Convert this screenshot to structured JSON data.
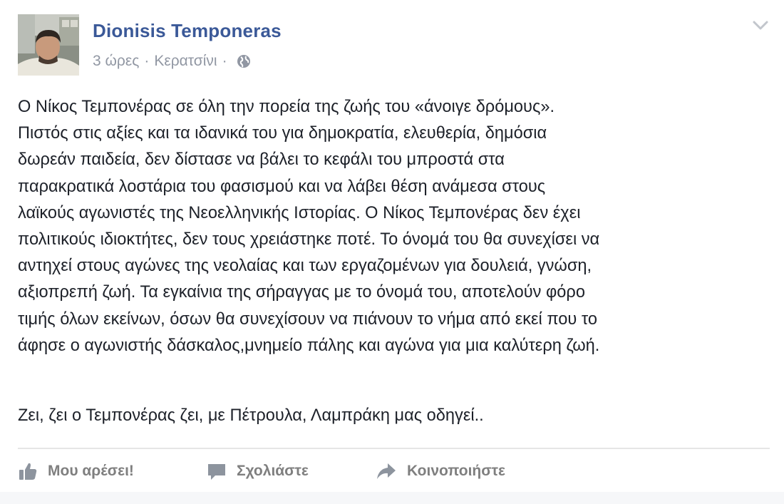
{
  "post": {
    "author": "Dionisis Temponeras",
    "time": "3 ώρες",
    "separator": "·",
    "location": "Κερατσίνι",
    "separator2": "·",
    "paragraph1": "Ο Νίκος Τεμπονέρας σε όλη την πορεία της ζωής του «άνοιγε δρόμους».\nΠιστός στις αξίες και τα ιδανικά του για δημοκρατία, ελευθερία, δημόσια\nδωρεάν παιδεία, δεν δίστασε να βάλει το κεφάλι του μπροστά στα\nπαρακρατικά λοστάρια του φασισμού και να λάβει θέση ανάμεσα στους\nλαϊκούς αγωνιστές της Νεοελληνικής Ιστορίας. Ο Νίκος Τεμπονέρας δεν έχει\nπολιτικούς ιδιοκτήτες, δεν τους χρειάστηκε ποτέ. Το όνομά του θα συνεχίσει να\nαντηχεί στους αγώνες της νεολαίας και των εργαζομένων για δουλειά, γνώση,\nαξιοπρεπή ζωή. Τα εγκαίνια της σήραγγας με το όνομά του, αποτελούν φόρο\nτιμής όλων εκείνων, όσων θα συνεχίσουν να πιάνουν το νήμα από εκεί που το\nάφησε ο αγωνιστής δάσκαλος,μνημείο πάλης και αγώνα για μια καλύτερη ζωή.",
    "paragraph2": "Ζει, ζει ο Τεμπονέρας ζει, με Πέτρουλα, Λαμπράκη μας οδηγεί.."
  },
  "actions": {
    "like": "Μου αρέσει!",
    "comment": "Σχολιάστε",
    "share": "Κοινοποιήστε"
  },
  "colors": {
    "author_link": "#3b5998",
    "meta_text": "#9197a3",
    "body_text": "#1d2129",
    "action_text": "#7f7f7f"
  },
  "icons": [
    "avatar-photo",
    "globe-icon",
    "chevron-down-icon",
    "like-icon",
    "comment-icon",
    "share-icon"
  ]
}
